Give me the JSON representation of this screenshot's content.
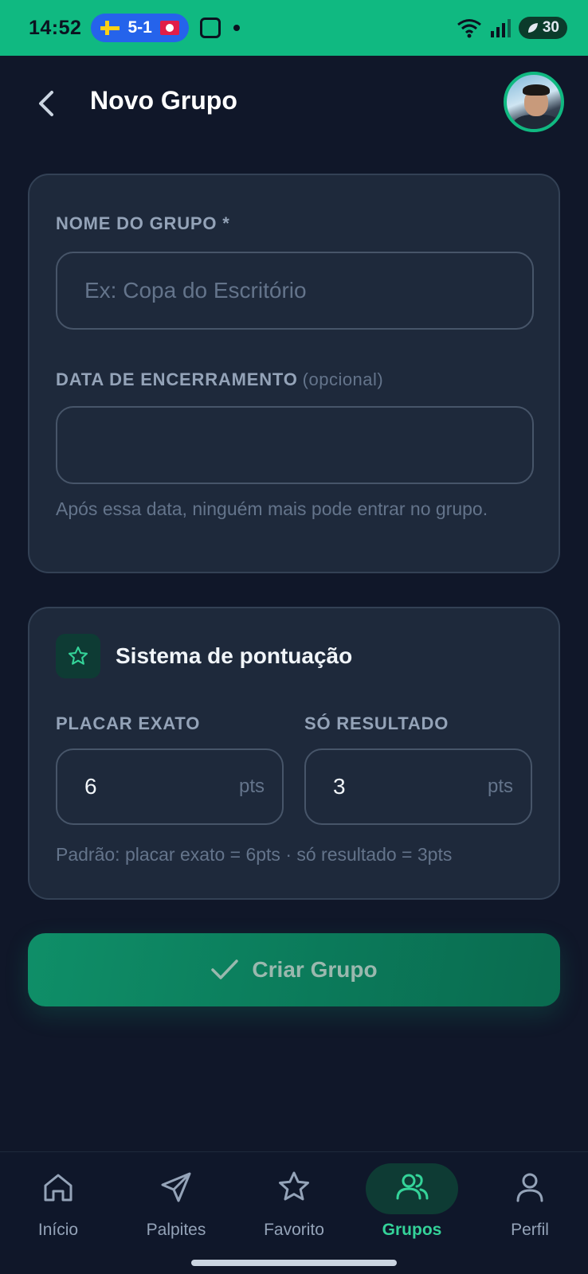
{
  "status_bar": {
    "time": "14:52",
    "score": "5-1",
    "battery": "30"
  },
  "header": {
    "title": "Novo Grupo"
  },
  "form": {
    "group_name_label": "NOME DO GRUPO *",
    "group_name_placeholder": "Ex: Copa do Escritório",
    "group_name_value": "",
    "end_date_label": "DATA DE ENCERRAMENTO",
    "end_date_optional": "(opcional)",
    "end_date_value": "",
    "end_date_helper": "Após essa data, ninguém mais pode entrar no grupo."
  },
  "scoring": {
    "title": "Sistema de pontuação",
    "exact_label": "PLACAR EXATO",
    "exact_value": "6",
    "result_label": "SÓ RESULTADO",
    "result_value": "3",
    "unit": "pts",
    "helper": "Padrão: placar exato = 6pts · só resultado = 3pts"
  },
  "create_button": {
    "label": "Criar Grupo"
  },
  "bottom_nav": {
    "items": [
      {
        "label": "Início",
        "icon": "home-icon",
        "active": false
      },
      {
        "label": "Palpites",
        "icon": "send-icon",
        "active": false
      },
      {
        "label": "Favorito",
        "icon": "star-icon",
        "active": false
      },
      {
        "label": "Grupos",
        "icon": "users-icon",
        "active": true
      },
      {
        "label": "Perfil",
        "icon": "user-icon",
        "active": false
      }
    ]
  },
  "colors": {
    "accent": "#10b981",
    "background": "#101729",
    "card": "#1e293b",
    "active_nav": "#34d399"
  }
}
